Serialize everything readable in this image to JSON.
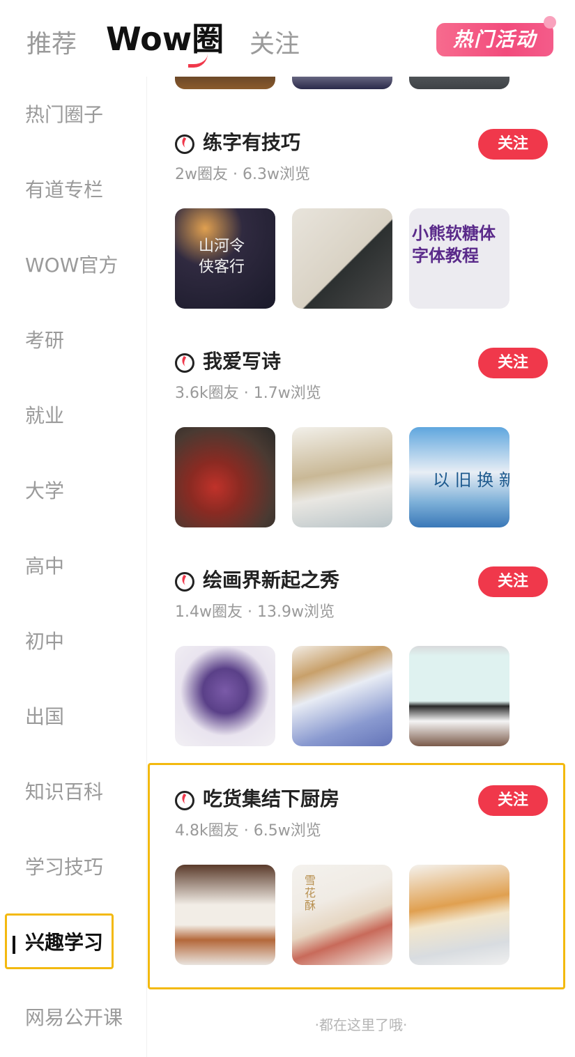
{
  "header": {
    "tab_recommend": "推荐",
    "tab_wow": "Wow圈",
    "tab_follow": "关注",
    "hot_activity": "热门活动"
  },
  "sidebar": {
    "items": [
      {
        "label": "热门圈子"
      },
      {
        "label": "有道专栏"
      },
      {
        "label": "WOW官方"
      },
      {
        "label": "考研"
      },
      {
        "label": "就业"
      },
      {
        "label": "大学"
      },
      {
        "label": "高中"
      },
      {
        "label": "初中"
      },
      {
        "label": "出国"
      },
      {
        "label": "知识百科"
      },
      {
        "label": "学习技巧"
      },
      {
        "label": "兴趣学习"
      },
      {
        "label": "网易公开课"
      }
    ],
    "active_index": 11
  },
  "circles": [
    {
      "title": "练字有技巧",
      "members": "2w圈友",
      "views": "6.3w浏览",
      "separator": " · ",
      "follow_label": "关注",
      "thumbs": [
        {
          "caption": "山河令\n侠客行"
        },
        {
          "caption": ""
        },
        {
          "caption": "小熊软糖体\n字体教程"
        }
      ]
    },
    {
      "title": "我爱写诗",
      "members": "3.6k圈友",
      "views": "1.7w浏览",
      "separator": " · ",
      "follow_label": "关注",
      "thumbs": [
        {
          "caption": ""
        },
        {
          "caption": ""
        },
        {
          "caption": "以 旧 换 新"
        }
      ]
    },
    {
      "title": "绘画界新起之秀",
      "members": "1.4w圈友",
      "views": "13.9w浏览",
      "separator": " · ",
      "follow_label": "关注",
      "thumbs": [
        {
          "caption": ""
        },
        {
          "caption": ""
        },
        {
          "caption": ""
        }
      ]
    },
    {
      "title": "吃货集结下厨房",
      "members": "4.8k圈友",
      "views": "6.5w浏览",
      "separator": " · ",
      "follow_label": "关注",
      "thumbs": [
        {
          "caption": ""
        },
        {
          "caption": "雪花酥"
        },
        {
          "caption": ""
        }
      ]
    }
  ],
  "footer_note": "·都在这里了哦·",
  "colors": {
    "accent_red": "#f0384b",
    "highlight_yellow": "#f3b90f"
  }
}
